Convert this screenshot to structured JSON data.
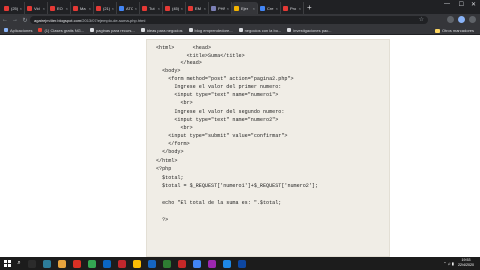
{
  "browser": {
    "tabs": [
      {
        "title": "(25)",
        "color": "#e53935"
      },
      {
        "title": "Vid",
        "color": "#e53935"
      },
      {
        "title": "EO",
        "color": "#e53935"
      },
      {
        "title": "Ma",
        "color": "#e53935"
      },
      {
        "title": "(21)",
        "color": "#e53935"
      },
      {
        "title": "ATC",
        "color": "#4285f4"
      },
      {
        "title": "Tut",
        "color": "#e53935"
      },
      {
        "title": "(45)",
        "color": "#e53935"
      },
      {
        "title": "EM",
        "color": "#e53935"
      },
      {
        "title": "PHP",
        "color": "#7b7fb5"
      },
      {
        "title": "Ejer",
        "color": "#f4b400",
        "active": true
      },
      {
        "title": "Cre",
        "color": "#4285f4"
      },
      {
        "title": "Pro",
        "color": "#e53935"
      }
    ],
    "close_glyph": "×",
    "new_tab": "+",
    "window_controls": {
      "minimize": "—",
      "maximize": "☐",
      "close": "✕"
    },
    "nav": {
      "back": "←",
      "forward": "→",
      "reload": "↻"
    },
    "url": {
      "host": "agatrejm4ter.blogspot.com",
      "path": "/2013/07/ejemplo-de-suma-php.html"
    },
    "star": "☆",
    "bookmarks": [
      {
        "label": "Aplicaciones",
        "color": "#8ab4f8"
      },
      {
        "label": "(1) Clases gratis NG...",
        "color": "#ea4335"
      },
      {
        "label": "paginas para recurs...",
        "color": "#dadce0"
      },
      {
        "label": "ideas para negocios",
        "color": "#dadce0"
      },
      {
        "label": "blog emprendedore...",
        "color": "#dadce0"
      },
      {
        "label": "negocios con la bo...",
        "color": "#dadce0"
      },
      {
        "label": "investigaciones pac...",
        "color": "#dadce0"
      }
    ],
    "other_bookmarks": "Otros marcadores"
  },
  "code_lines": [
    "<html>      <head>",
    "          <title>Suma</title>",
    "        </head>",
    "  <body>",
    "    <form method=\"post\" action=\"pagina2.php\">",
    "      Ingrese el valor del primer numero:",
    "      <input type=\"text\" name=\"numero1\">",
    "        <br>",
    "      Ingrese el valor del segundo numero:",
    "      <input type=\"text\" name=\"numero2\">",
    "        <br>",
    "    <input type=\"submit\" value=\"confirmar\">",
    "    </form>",
    "  </body>",
    "</html>",
    "<?php",
    "  $total;",
    "  $total = $_REQUEST['numero1']+$_REQUEST['numero2'];",
    "",
    "  echo \"El total de la suma es: \".$total;",
    "",
    "  ?>"
  ],
  "taskbar": {
    "search_glyph": "⌕",
    "apps": [
      {
        "color": "#2b2b2b"
      },
      {
        "color": "#2d7d9a"
      },
      {
        "color": "#e8a33d"
      },
      {
        "color": "#d93025"
      },
      {
        "color": "#34a853"
      },
      {
        "color": "#0a66c2"
      },
      {
        "color": "#c1272d"
      },
      {
        "color": "#fbbc05"
      },
      {
        "color": "#1565c0"
      },
      {
        "color": "#2e7d32"
      },
      {
        "color": "#c62828"
      },
      {
        "color": "#4285f4"
      },
      {
        "color": "#9c27b0"
      },
      {
        "color": "#1e88e5"
      },
      {
        "color": "#0d47a1"
      }
    ],
    "tray_icons": "⌃ ♫ ▮",
    "time": "19:53",
    "date": "22/4/2020"
  }
}
